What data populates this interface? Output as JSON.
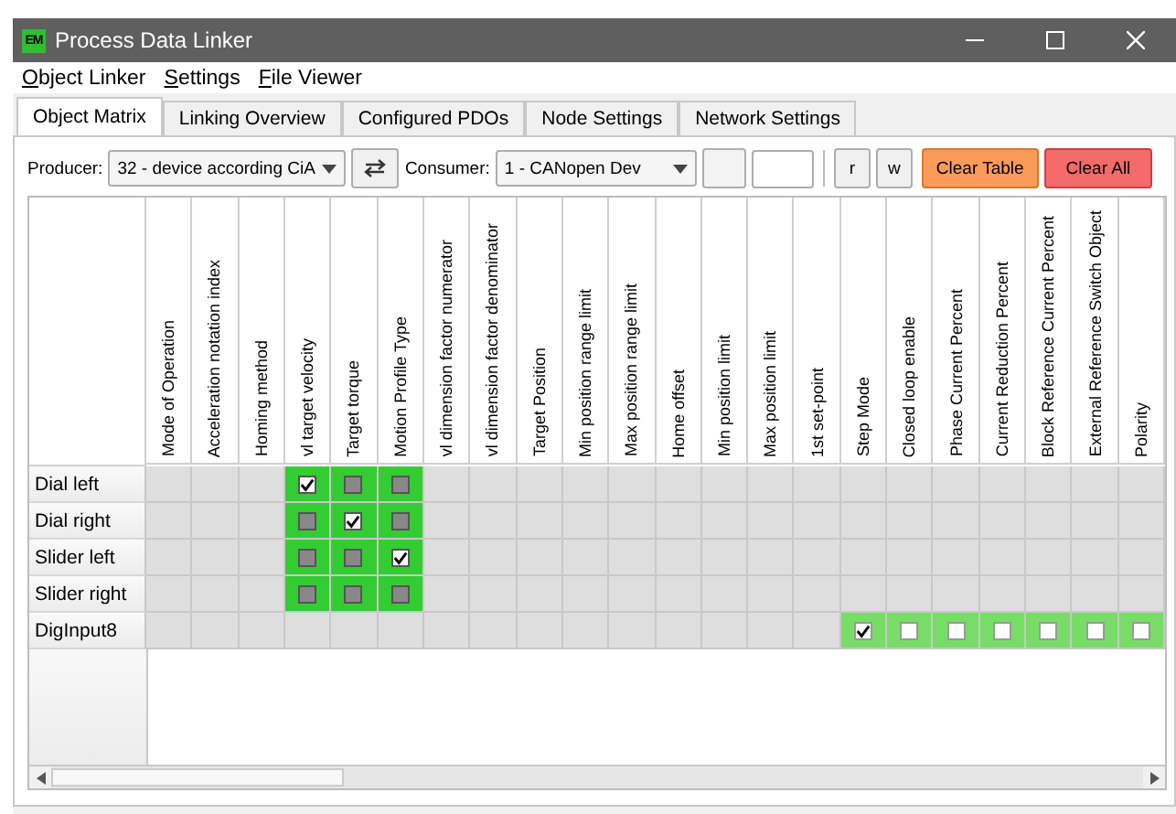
{
  "window": {
    "logo": "EM",
    "title": "Process Data Linker"
  },
  "menu": [
    {
      "label": "Object Linker"
    },
    {
      "label": "Settings"
    },
    {
      "label": "File Viewer"
    }
  ],
  "tabs": [
    {
      "label": "Object Matrix",
      "selected": true
    },
    {
      "label": "Linking Overview",
      "selected": false
    },
    {
      "label": "Configured PDOs",
      "selected": false
    },
    {
      "label": "Node Settings",
      "selected": false
    },
    {
      "label": "Network Settings",
      "selected": false
    }
  ],
  "toolbar": {
    "producer_label": "Producer:",
    "producer": "32 - device according CiA",
    "consumer_label": "Consumer:",
    "consumer": "1 - CANopen Dev",
    "read_button": "r",
    "write_button": "w",
    "clear_table": "Clear Table",
    "clear_all": "Clear All"
  },
  "table": {
    "columns": [
      "Mode of Operation",
      "Acceleration notation index",
      "Homing method",
      "vl target velocity",
      "Target torque",
      "Motion Profile Type",
      "vl dimension factor numerator",
      "vl dimension factor denominator",
      "Target Position",
      "Min position range limit",
      "Max position range limit",
      "Home offset",
      "Min position limit",
      "Max position limit",
      "1st set-point",
      "Step Mode",
      "Closed loop enable",
      "Phase Current Percent",
      "Current Reduction Percent",
      "Block Reference Current Percent",
      "External Reference Switch Object",
      "Polarity"
    ],
    "rows": [
      {
        "label": "Dial left",
        "cells": [
          {
            "kind": "blank"
          },
          {
            "kind": "blank"
          },
          {
            "kind": "blank"
          },
          {
            "kind": "checkbox",
            "checked": true,
            "color": "#33cc33"
          },
          {
            "kind": "checkbox",
            "checked": false,
            "color": "#33cc33"
          },
          {
            "kind": "checkbox",
            "checked": false,
            "color": "#33cc33"
          },
          {
            "kind": "blank"
          },
          {
            "kind": "blank"
          },
          {
            "kind": "blank"
          },
          {
            "kind": "blank"
          },
          {
            "kind": "blank"
          },
          {
            "kind": "blank"
          },
          {
            "kind": "blank"
          },
          {
            "kind": "blank"
          },
          {
            "kind": "blank"
          },
          {
            "kind": "blank"
          },
          {
            "kind": "blank"
          },
          {
            "kind": "blank"
          },
          {
            "kind": "blank"
          },
          {
            "kind": "blank"
          },
          {
            "kind": "blank"
          },
          {
            "kind": "blank"
          }
        ]
      },
      {
        "label": "Dial right",
        "cells": [
          {
            "kind": "blank"
          },
          {
            "kind": "blank"
          },
          {
            "kind": "blank"
          },
          {
            "kind": "checkbox",
            "checked": false,
            "color": "#33cc33"
          },
          {
            "kind": "checkbox",
            "checked": true,
            "color": "#33cc33"
          },
          {
            "kind": "checkbox",
            "checked": false,
            "color": "#33cc33"
          },
          {
            "kind": "blank"
          },
          {
            "kind": "blank"
          },
          {
            "kind": "blank"
          },
          {
            "kind": "blank"
          },
          {
            "kind": "blank"
          },
          {
            "kind": "blank"
          },
          {
            "kind": "blank"
          },
          {
            "kind": "blank"
          },
          {
            "kind": "blank"
          },
          {
            "kind": "blank"
          },
          {
            "kind": "blank"
          },
          {
            "kind": "blank"
          },
          {
            "kind": "blank"
          },
          {
            "kind": "blank"
          },
          {
            "kind": "blank"
          },
          {
            "kind": "blank"
          }
        ]
      },
      {
        "label": "Slider left",
        "cells": [
          {
            "kind": "blank"
          },
          {
            "kind": "blank"
          },
          {
            "kind": "blank"
          },
          {
            "kind": "checkbox",
            "checked": false,
            "color": "#33cc33"
          },
          {
            "kind": "checkbox",
            "checked": false,
            "color": "#33cc33"
          },
          {
            "kind": "checkbox",
            "checked": true,
            "color": "#33cc33"
          },
          {
            "kind": "blank"
          },
          {
            "kind": "blank"
          },
          {
            "kind": "blank"
          },
          {
            "kind": "blank"
          },
          {
            "kind": "blank"
          },
          {
            "kind": "blank"
          },
          {
            "kind": "blank"
          },
          {
            "kind": "blank"
          },
          {
            "kind": "blank"
          },
          {
            "kind": "blank"
          },
          {
            "kind": "blank"
          },
          {
            "kind": "blank"
          },
          {
            "kind": "blank"
          },
          {
            "kind": "blank"
          },
          {
            "kind": "blank"
          },
          {
            "kind": "blank"
          }
        ]
      },
      {
        "label": "Slider right",
        "cells": [
          {
            "kind": "blank"
          },
          {
            "kind": "blank"
          },
          {
            "kind": "blank"
          },
          {
            "kind": "checkbox",
            "checked": false,
            "color": "#33cc33"
          },
          {
            "kind": "checkbox",
            "checked": false,
            "color": "#33cc33"
          },
          {
            "kind": "checkbox",
            "checked": false,
            "color": "#33cc33"
          },
          {
            "kind": "blank"
          },
          {
            "kind": "blank"
          },
          {
            "kind": "blank"
          },
          {
            "kind": "blank"
          },
          {
            "kind": "blank"
          },
          {
            "kind": "blank"
          },
          {
            "kind": "blank"
          },
          {
            "kind": "blank"
          },
          {
            "kind": "blank"
          },
          {
            "kind": "blank"
          },
          {
            "kind": "blank"
          },
          {
            "kind": "blank"
          },
          {
            "kind": "blank"
          },
          {
            "kind": "blank"
          },
          {
            "kind": "blank"
          },
          {
            "kind": "blank"
          }
        ]
      },
      {
        "label": "DigInput8",
        "cells": [
          {
            "kind": "blank"
          },
          {
            "kind": "blank"
          },
          {
            "kind": "blank"
          },
          {
            "kind": "blank"
          },
          {
            "kind": "blank"
          },
          {
            "kind": "blank"
          },
          {
            "kind": "blank"
          },
          {
            "kind": "blank"
          },
          {
            "kind": "blank"
          },
          {
            "kind": "blank"
          },
          {
            "kind": "blank"
          },
          {
            "kind": "blank"
          },
          {
            "kind": "blank"
          },
          {
            "kind": "blank"
          },
          {
            "kind": "blank"
          },
          {
            "kind": "plain_checkbox",
            "checked": true,
            "color": "#77dd66"
          },
          {
            "kind": "plain_checkbox",
            "checked": false,
            "color": "#77dd66"
          },
          {
            "kind": "plain_checkbox",
            "checked": false,
            "color": "#77dd66"
          },
          {
            "kind": "plain_checkbox",
            "checked": false,
            "color": "#77dd66"
          },
          {
            "kind": "plain_checkbox",
            "checked": false,
            "color": "#77dd66"
          },
          {
            "kind": "plain_checkbox",
            "checked": false,
            "color": "#77dd66"
          },
          {
            "kind": "plain_checkbox",
            "checked": false,
            "color": "#77dd66"
          }
        ]
      }
    ]
  }
}
